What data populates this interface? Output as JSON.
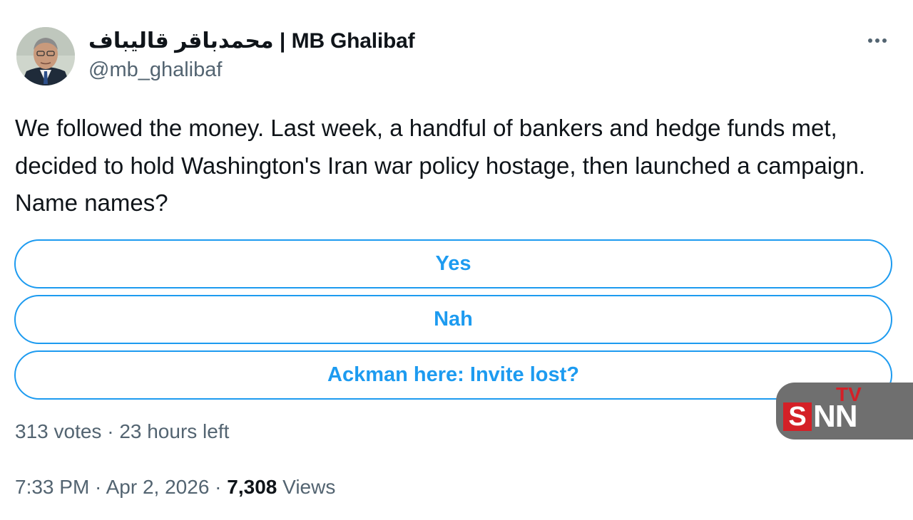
{
  "tweet": {
    "display_name": "محمدباقر قالیباف | MB Ghalibaf",
    "handle": "@mb_ghalibaf",
    "more_icon": "more-horizontal-icon",
    "text": "We followed the money. Last week, a handful of bankers and hedge funds met, decided to hold Washington's Iran war policy hostage, then launched a campaign. Name names?",
    "poll": {
      "options": [
        "Yes",
        "Nah",
        "Ackman here: Invite lost?"
      ],
      "votes": "313 votes",
      "separator": " · ",
      "time_left": "23 hours left"
    },
    "time": "7:33 PM",
    "date": "Apr 2, 2026",
    "views_count": "7,308",
    "views_label": "Views"
  },
  "watermark": {
    "s": "S",
    "nn": "NN",
    "tv": "TV"
  },
  "colors": {
    "accent": "#1d9bf0",
    "text": "#0f1419",
    "secondary": "#536471",
    "watermark_bg": "#6f6f6f",
    "watermark_red": "#d42027"
  }
}
